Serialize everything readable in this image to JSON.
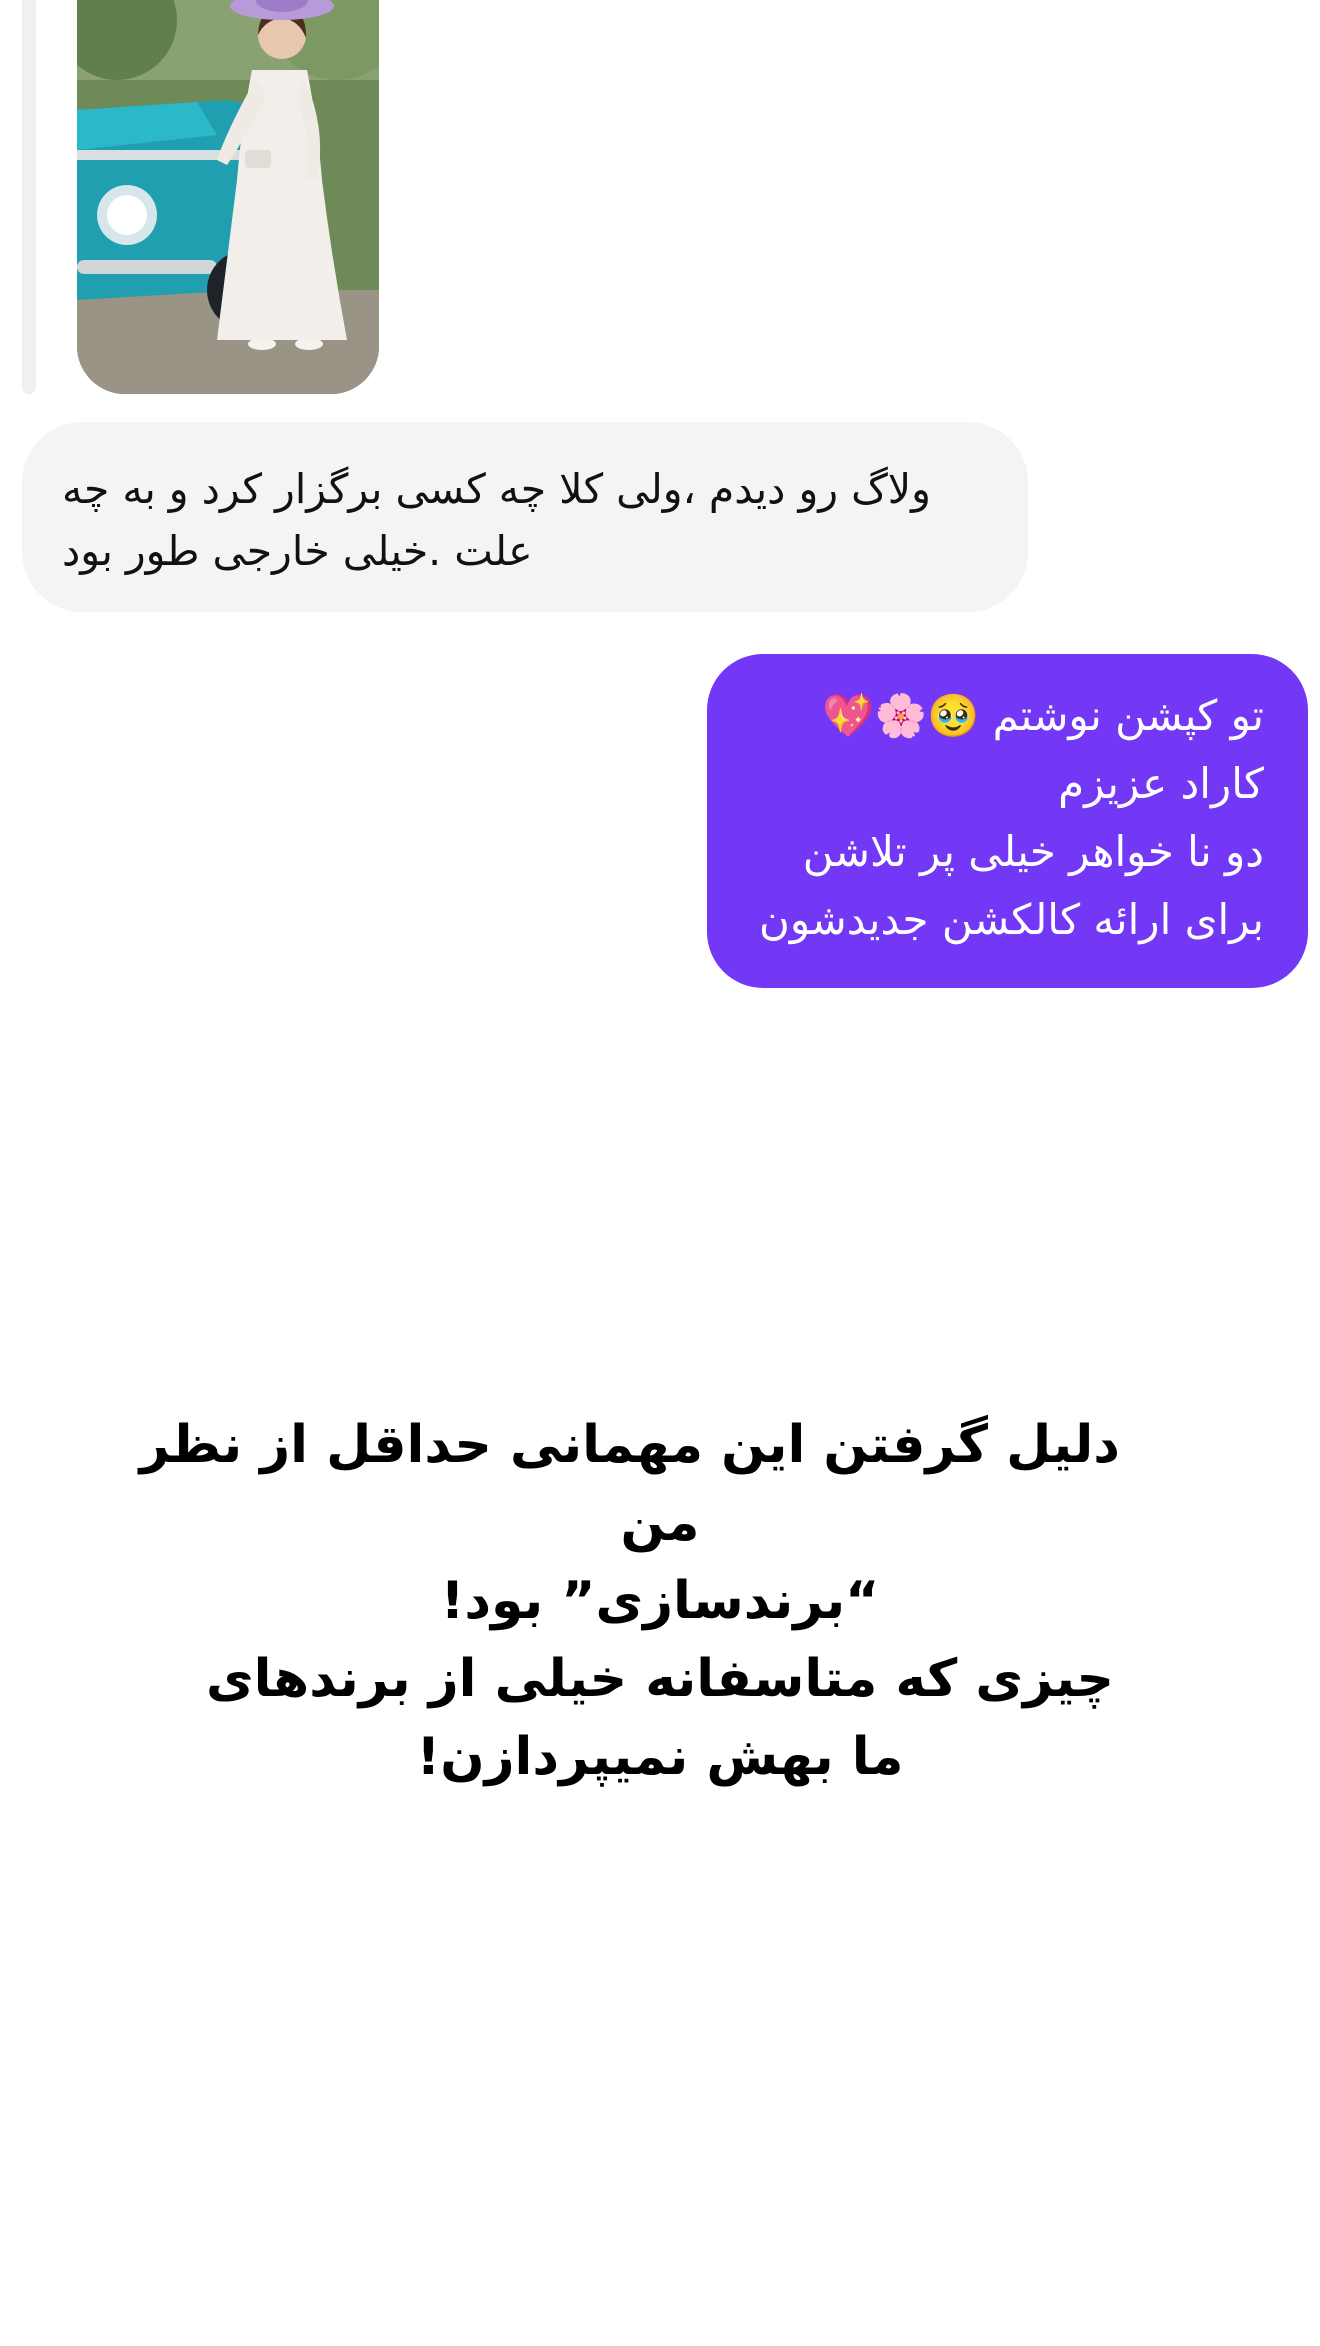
{
  "thread": {
    "shared_post": {
      "image_alt": "woman in white dress beside turquoise vintage car"
    },
    "incoming_message": {
      "lines": [
        "ولاگ رو دیدم ،ولی کلا چه کسی برگزار کرد و به چه",
        "علت .خیلی خارجی طور بود"
      ]
    },
    "outgoing_message": {
      "lines": [
        "تو کپشن نوشتم 🥹🌸💖",
        "کاراد عزیزم",
        "دو نا خواهر خیلی پر تلاشن",
        "برای ارائه کالکشن جدیدشون"
      ]
    }
  },
  "story_caption": {
    "lines": [
      "دلیل گرفتن این مهمانی حداقل از نظر",
      "من",
      "“برندسازی” بود!",
      "چیزی که متاسفانه خیلی از برندهای",
      "ما بهش نمیپردازن!"
    ]
  },
  "colors": {
    "outgoing_bubble": "#7238f5",
    "incoming_bubble": "#f3f4f6",
    "background": "#ffffff"
  }
}
